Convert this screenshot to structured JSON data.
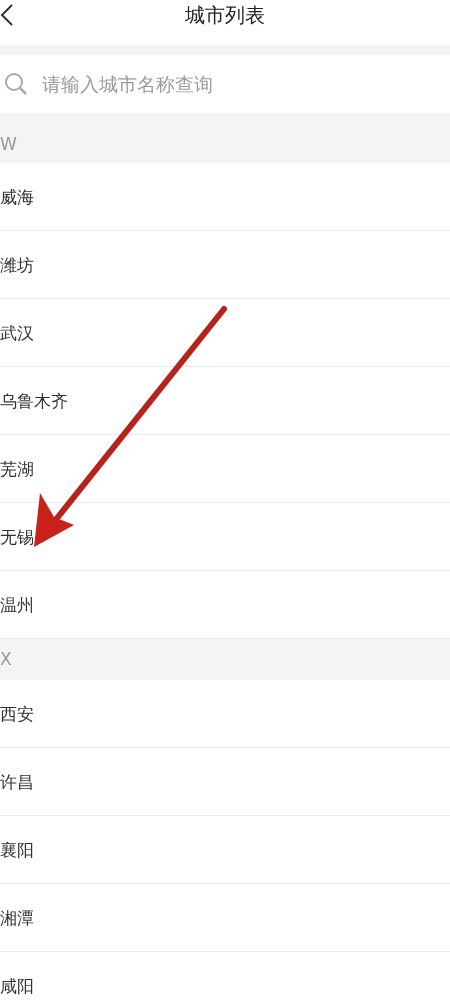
{
  "header": {
    "title": "城市列表"
  },
  "search": {
    "placeholder": "请输入城市名称查询"
  },
  "sections": [
    {
      "letter": "W",
      "cities": [
        "威海",
        "潍坊",
        "武汉",
        "乌鲁木齐",
        "芜湖",
        "无锡",
        "温州"
      ]
    },
    {
      "letter": "X",
      "cities": [
        "西安",
        "许昌",
        "襄阳",
        "湘潭",
        "咸阳"
      ]
    }
  ]
}
